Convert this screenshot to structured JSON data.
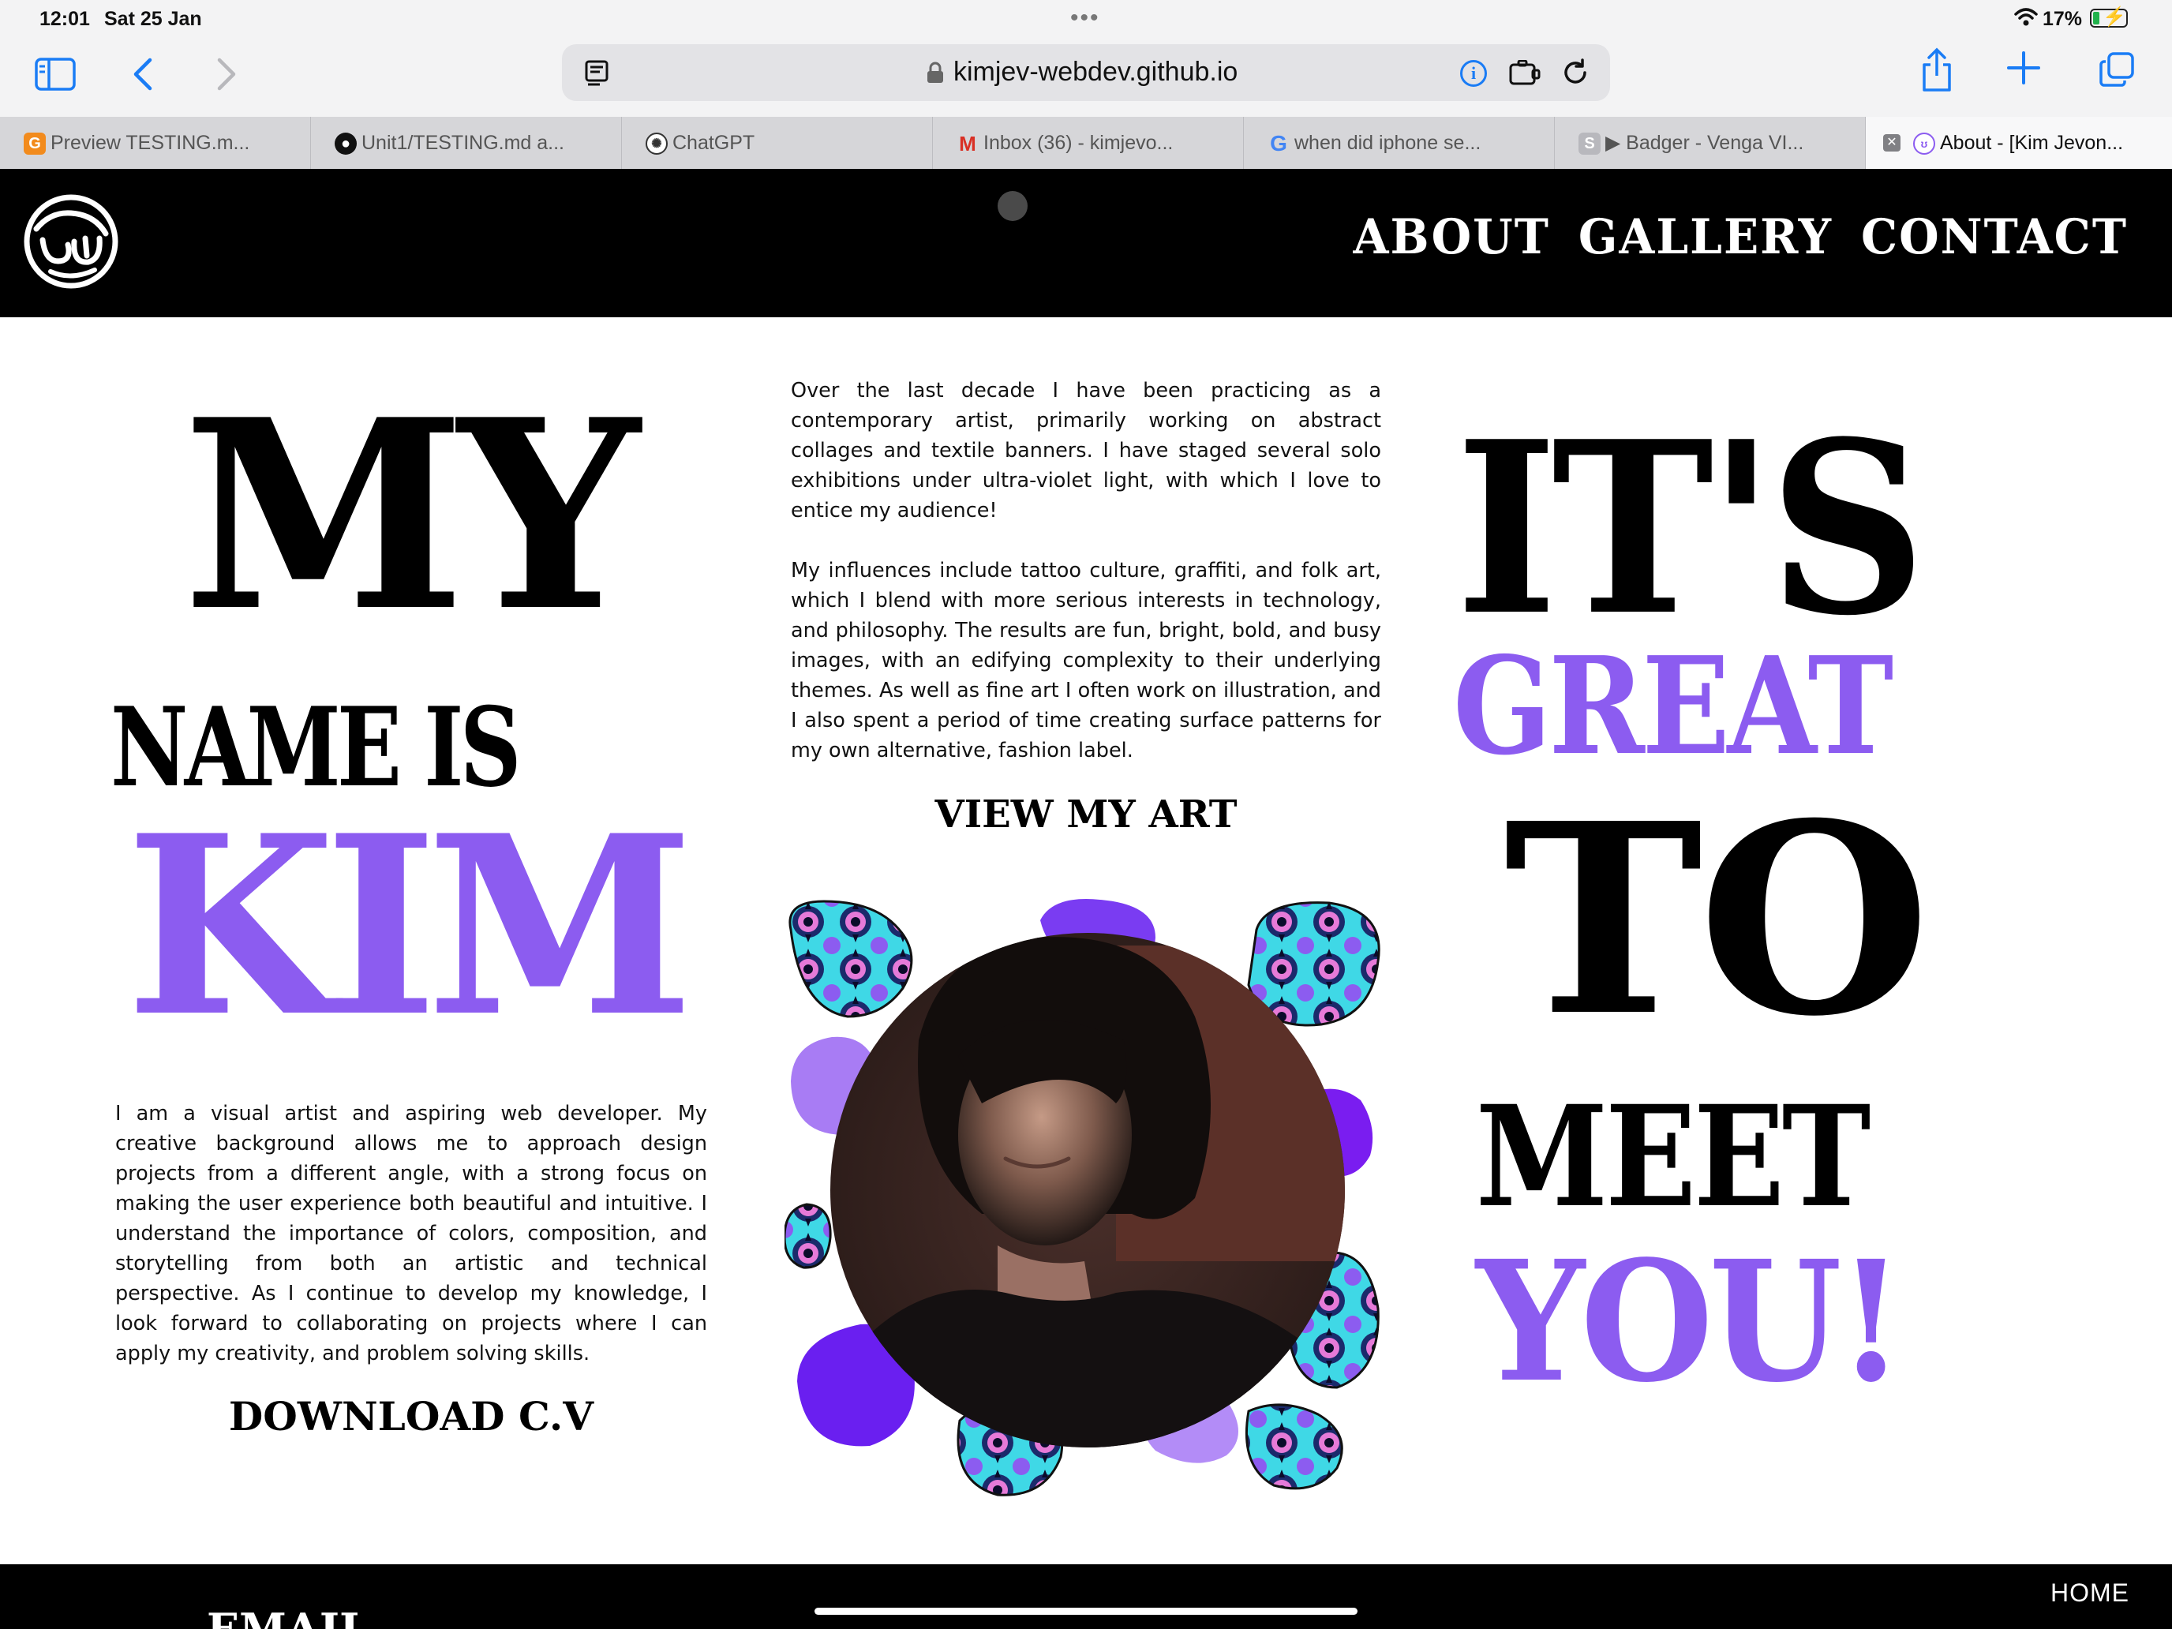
{
  "status_bar": {
    "time": "12:01",
    "date": "Sat 25 Jan",
    "battery": "17%"
  },
  "browser": {
    "url": "kimjev-webdev.github.io",
    "accent_color": "#1a7cf5",
    "tabs": [
      {
        "label": "Preview TESTING.m...",
        "icon": "preview-favicon-icon",
        "color": "#f28b1d"
      },
      {
        "label": "Unit1/TESTING.md a...",
        "icon": "github-favicon-icon",
        "color": "#111111"
      },
      {
        "label": "ChatGPT",
        "icon": "chatgpt-favicon-icon",
        "color": "#333333"
      },
      {
        "label": "Inbox (36) - kimjevo...",
        "icon": "gmail-favicon-icon",
        "color": "#d93025"
      },
      {
        "label": "when did iphone se...",
        "icon": "google-favicon-icon",
        "color": "#4285f4"
      },
      {
        "label": "▶ Badger - Venga VI...",
        "icon": "s-favicon-icon",
        "color": "#b8b8bd"
      },
      {
        "label": "About - [Kim Jevon...",
        "icon": "kim-logo-favicon-icon",
        "color": "#8c5cf0"
      }
    ]
  },
  "site": {
    "nav": [
      "ABOUT",
      "GALLERY",
      "CONTACT"
    ],
    "headline_left": {
      "line1": "MY",
      "line2": "NAME IS",
      "line3": "KIM"
    },
    "headline_right": {
      "line1": "IT'S",
      "line2": "GREAT",
      "line3": "TO",
      "line4": "MEET",
      "line5": "YOU!"
    },
    "intro_paragraph_1": "Over the last decade I have been practicing as a contemporary artist, primarily working on abstract collages and textile banners. I have staged several solo exhibitions under ultra-violet light, with which I love to entice my audience!",
    "intro_paragraph_2": "My influences include tattoo culture, graffiti, and folk art, which I blend with more serious interests in technology, and philosophy. The results are fun, bright, bold, and busy images, with an edifying complexity to their underlying themes. As well as fine art I often work on illustration, and I also spent a period of time creating surface patterns for my own alternative, fashion label.",
    "view_art_label": "VIEW MY ART",
    "bio": "I am a visual artist and aspiring web developer. My creative background allows me to approach design projects from a different angle, with a strong focus on making the user experience both beautiful and intuitive. I understand the importance of colors, composition, and storytelling from both an artistic and technical perspective. As I continue to develop my knowledge, I look forward to collaborating on projects where I can apply my creativity, and problem solving skills.",
    "download_cv_label": "DOWNLOAD C.V",
    "footer_email": "EMAIL",
    "footer_home": "HOME",
    "colors": {
      "purple": "#8c5cf0",
      "deep_purple": "#6a1ff0",
      "black": "#000000",
      "cyan": "#3fd8e6"
    }
  }
}
